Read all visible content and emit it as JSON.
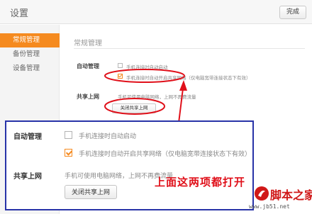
{
  "window": {
    "title": "设置",
    "done_label": "完成"
  },
  "sidebar": {
    "items": [
      {
        "label": "常规管理",
        "active": true
      },
      {
        "label": "备份管理",
        "active": false
      },
      {
        "label": "设备管理",
        "active": false
      }
    ]
  },
  "main": {
    "section_title": "常规管理",
    "auto_manage": {
      "label": "自动管理",
      "options": [
        {
          "text": "手机连接时自动启动",
          "checked": false
        },
        {
          "text": "手机连接时自动开启共享网络（仅电脑宽带连接状态下有效）",
          "checked": true
        }
      ]
    },
    "share_net": {
      "label": "共享上网",
      "desc": "手机可使用电脑网络，上网不再费流量",
      "button": "关闭共享上网"
    }
  },
  "zoom": {
    "auto_label": "自动管理",
    "option1": "手机连接时自动启动",
    "option2": "手机连接时自动开启共享网络（仅电脑宽带连接状态下有效）",
    "share_label": "共享上网",
    "share_desc": "手机可使用电脑网络，上网不再费流量",
    "share_button": "关闭共享上网"
  },
  "annotation": {
    "callout": "上面这两项都打开",
    "color": "#e0101a"
  },
  "watermark": {
    "name": "脚本之家",
    "url": "www.jb51.net"
  },
  "colors": {
    "accent": "#f58a1f",
    "frame": "#2833a8"
  }
}
